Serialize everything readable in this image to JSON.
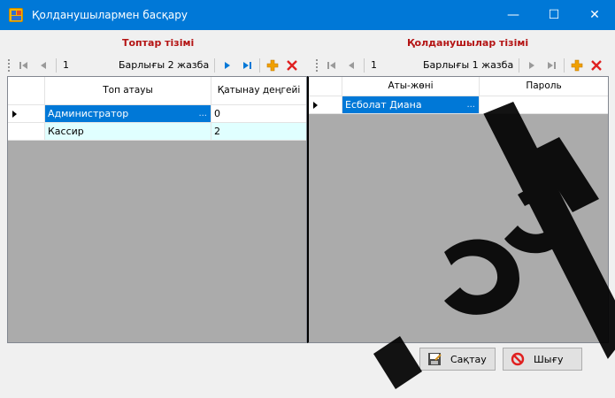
{
  "window": {
    "title": "Қолданушылармен басқару",
    "min": "—",
    "max": "☐",
    "close": "✕"
  },
  "left": {
    "section_title": "Топтар тізімі",
    "position": "1",
    "count_text": "Барлығы 2 жазба",
    "columns": [
      "Топ атауы",
      "Қатынау деңгейі"
    ],
    "rows": [
      {
        "name": "Администратор",
        "level": "0"
      },
      {
        "name": "Кассир",
        "level": "2"
      }
    ]
  },
  "right": {
    "section_title": "Қолданушылар тізімі",
    "position": "1",
    "count_text": "Барлығы 1 жазба",
    "columns": [
      "Аты-жөні",
      "Пароль"
    ],
    "rows": [
      {
        "name": "Есболат Диана",
        "password": ""
      }
    ]
  },
  "buttons": {
    "save": "Сақтау",
    "exit": "Шығу"
  },
  "colors": {
    "titlebar": "#0078d7",
    "section_title": "#b41414",
    "selected_row": "#0078d7",
    "alt_row": "#e0ffff",
    "nav_active": "#0078d7",
    "add": "#f0a000",
    "delete": "#e02020"
  },
  "icons": [
    "app-icon",
    "first-record-icon",
    "prev-record-icon",
    "next-record-icon",
    "last-record-icon",
    "add-icon",
    "delete-icon",
    "save-icon",
    "no-entry-icon"
  ]
}
